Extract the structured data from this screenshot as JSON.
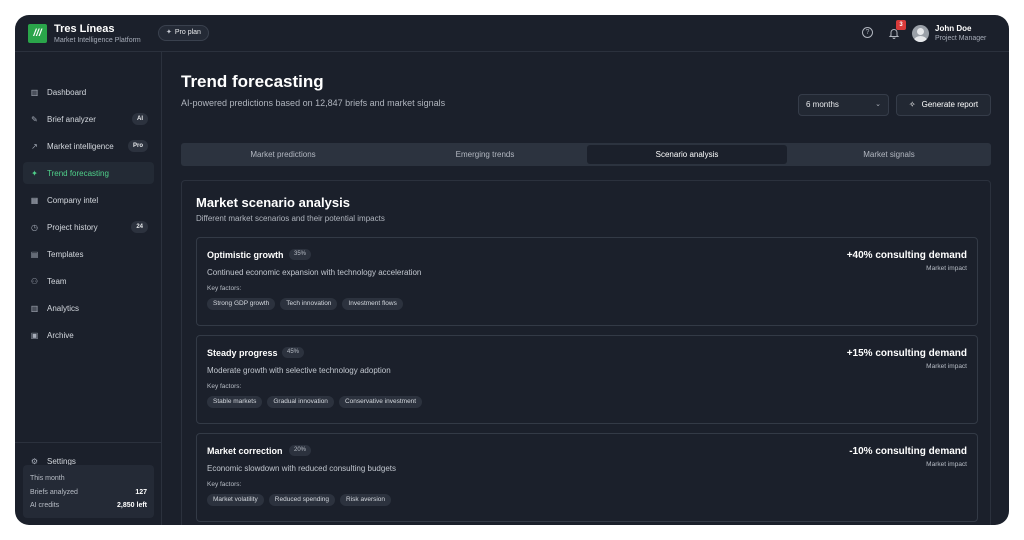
{
  "app": {
    "logo_glyph": "///",
    "title": "Tres Líneas",
    "subtitle": "Market Intelligence Platform",
    "plan": "Pro plan"
  },
  "topbar": {
    "help_icon": "?",
    "notification_count": "3",
    "user_name": "John Doe",
    "user_role": "Project Manager"
  },
  "sidebar": {
    "items": [
      {
        "label": "Dashboard",
        "icon": "bar-chart-icon",
        "glyph": "▥",
        "badge": "",
        "active": false
      },
      {
        "label": "Brief analyzer",
        "icon": "brief-icon",
        "glyph": "✎",
        "badge": "AI",
        "active": false
      },
      {
        "label": "Market intelligence",
        "icon": "trend-up-icon",
        "glyph": "↗",
        "badge": "Pro",
        "active": false
      },
      {
        "label": "Trend forecasting",
        "icon": "sparkle-icon",
        "glyph": "✦",
        "badge": "",
        "active": true
      },
      {
        "label": "Company intel",
        "icon": "building-icon",
        "glyph": "▦",
        "badge": "",
        "active": false
      },
      {
        "label": "Project history",
        "icon": "clock-icon",
        "glyph": "◷",
        "badge": "24",
        "active": false
      },
      {
        "label": "Templates",
        "icon": "document-icon",
        "glyph": "▤",
        "badge": "",
        "active": false
      },
      {
        "label": "Team",
        "icon": "users-icon",
        "glyph": "⚇",
        "badge": "",
        "active": false
      },
      {
        "label": "Analytics",
        "icon": "analytics-icon",
        "glyph": "▥",
        "badge": "",
        "active": false
      },
      {
        "label": "Archive",
        "icon": "archive-icon",
        "glyph": "▣",
        "badge": "",
        "active": false
      }
    ],
    "settings_label": "Settings",
    "settings_glyph": "⚙",
    "usage": {
      "title": "This month",
      "briefs_label": "Briefs analyzed",
      "briefs_value": "127",
      "credits_label": "AI credits",
      "credits_value": "2,850 left"
    }
  },
  "main": {
    "title": "Trend forecasting",
    "subtitle": "AI-powered predictions based on 12,847 briefs and market signals",
    "period": "6 months",
    "generate_label": "Generate report",
    "tabs": [
      {
        "label": "Market predictions",
        "active": false
      },
      {
        "label": "Emerging trends",
        "active": false
      },
      {
        "label": "Scenario analysis",
        "active": true
      },
      {
        "label": "Market signals",
        "active": false
      }
    ],
    "panel": {
      "title": "Market scenario analysis",
      "subtitle": "Different market scenarios and their potential impacts",
      "key_factors_label": "Key factors:",
      "impact_label": "Market impact",
      "scenarios": [
        {
          "name": "Optimistic growth",
          "probability": "35%",
          "description": "Continued economic expansion with technology acceleration",
          "factors": [
            "Strong GDP growth",
            "Tech innovation",
            "Investment flows"
          ],
          "impact": "+40% consulting demand"
        },
        {
          "name": "Steady progress",
          "probability": "45%",
          "description": "Moderate growth with selective technology adoption",
          "factors": [
            "Stable markets",
            "Gradual innovation",
            "Conservative investment"
          ],
          "impact": "+15% consulting demand"
        },
        {
          "name": "Market correction",
          "probability": "20%",
          "description": "Economic slowdown with reduced consulting budgets",
          "factors": [
            "Market volatility",
            "Reduced spending",
            "Risk aversion"
          ],
          "impact": "-10% consulting demand"
        }
      ]
    }
  }
}
